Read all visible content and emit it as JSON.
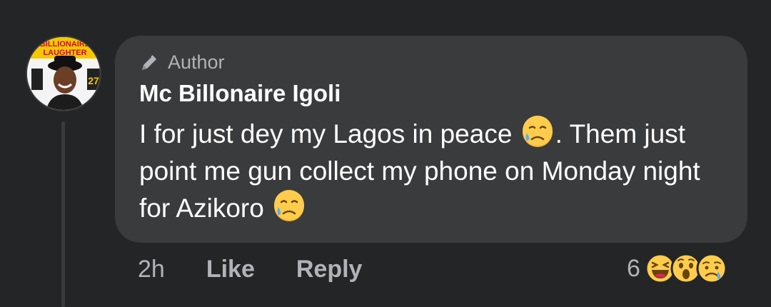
{
  "comment": {
    "author_badge": "Author",
    "author_name": "Mc Billonaire Igoli",
    "text_part1": "I for just dey my Lagos in peace",
    "text_part2": ". Them just point me gun collect my phone on Monday night for Azikoro",
    "emoji": "sad-but-relieved-face"
  },
  "actions": {
    "time": "2h",
    "like": "Like",
    "reply": "Reply"
  },
  "reactions": {
    "count": "6",
    "types": [
      "haha",
      "wow",
      "sad"
    ]
  },
  "avatar": {
    "poster_text": [
      "BILLIONAIRE",
      "LAUGHTER",
      "27"
    ]
  },
  "colors": {
    "background": "#242526",
    "bubble": "#3a3b3c",
    "text": "#ffffff",
    "muted": "#b0b3b8"
  }
}
